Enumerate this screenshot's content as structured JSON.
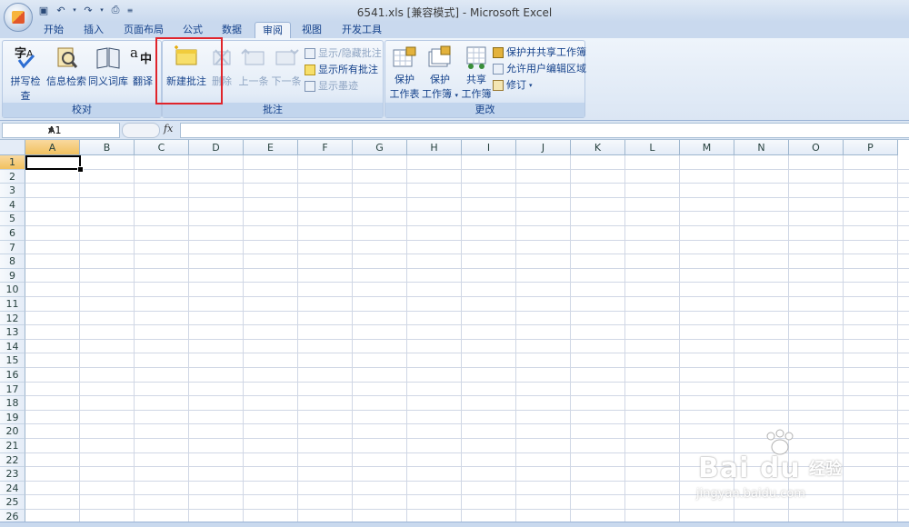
{
  "window": {
    "title": "6541.xls  [兼容模式] - Microsoft Excel"
  },
  "tabs": [
    "开始",
    "插入",
    "页面布局",
    "公式",
    "数据",
    "审阅",
    "视图",
    "开发工具"
  ],
  "active_tab": "审阅",
  "ribbon": {
    "proofing": {
      "label": "校对",
      "spelling": "拼写检查",
      "research": "信息检索",
      "thesaurus": "同义词库",
      "translate": "翻译"
    },
    "comments": {
      "label": "批注",
      "new_comment": "新建批注",
      "delete": "删除",
      "previous": "上一条",
      "next": "下一条",
      "show_hide": "显示/隐藏批注",
      "show_all": "显示所有批注",
      "show_ink": "显示墨迹"
    },
    "changes": {
      "label": "更改",
      "protect_sheet_1": "保护",
      "protect_sheet_2": "工作表",
      "protect_workbook_1": "保护",
      "protect_workbook_2": "工作簿",
      "share_workbook_1": "共享",
      "share_workbook_2": "工作簿",
      "protect_share": "保护并共享工作簿",
      "allow_edit": "允许用户编辑区域",
      "track_changes": "修订"
    }
  },
  "formula_bar": {
    "name_box": "A1",
    "fx": "fx",
    "formula": ""
  },
  "grid": {
    "columns": [
      "A",
      "B",
      "C",
      "D",
      "E",
      "F",
      "G",
      "H",
      "I",
      "J",
      "K",
      "L",
      "M",
      "N",
      "O",
      "P"
    ],
    "rows": [
      "1",
      "2",
      "3",
      "4",
      "5",
      "6",
      "7",
      "8",
      "9",
      "10",
      "11",
      "12",
      "13",
      "14",
      "15",
      "16",
      "17",
      "18",
      "19",
      "20",
      "21",
      "22",
      "23",
      "24",
      "25",
      "26"
    ],
    "active_cell": "A1"
  },
  "watermark": {
    "logo": "Bai du",
    "text": "经验",
    "url": "jingyan.baidu.com"
  },
  "colors": {
    "highlight": "#e0242b",
    "ribbon": "#dbe6f4",
    "selection_header": "#f1c15f"
  }
}
